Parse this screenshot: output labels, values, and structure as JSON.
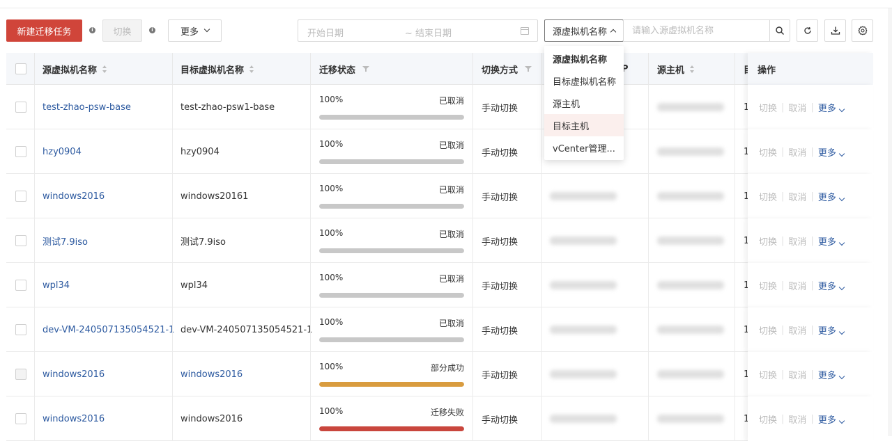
{
  "toolbar": {
    "new_task_label": "新建迁移任务",
    "switch_label": "切换",
    "more_label": "更多",
    "info_mark": "i",
    "date_start_placeholder": "开始日期",
    "date_end_placeholder": "~ 结束日期",
    "field_select_value": "源虚拟机名称",
    "search_placeholder": "请输入源虚拟机名称"
  },
  "dropdown": {
    "options": [
      "源虚拟机名称",
      "目标虚拟机名称",
      "源主机",
      "目标主机",
      "vCenter管理..."
    ],
    "selected": "源虚拟机名称",
    "hovered": "目标主机"
  },
  "table": {
    "columns": {
      "source_vm": "源虚拟机名称",
      "target_vm": "目标虚拟机名称",
      "status": "迁移状态",
      "switch_mode": "切换方式",
      "ip_partial": "P",
      "source_host": "源主机",
      "target_host_partial": "目",
      "actions": "操作"
    },
    "rows": [
      {
        "source_vm": "test-zhao-psw-base",
        "target_vm": "test-zhao-psw1-base",
        "target_is_link": false,
        "progress": "100%",
        "progress_value": 100,
        "status": "已取消",
        "bar_color": "#c8c8c8",
        "switch_mode": "手动切换",
        "target_host_partial": "1",
        "checkbox_disabled": false
      },
      {
        "source_vm": "hzy0904",
        "target_vm": "hzy0904",
        "target_is_link": false,
        "progress": "100%",
        "progress_value": 100,
        "status": "已取消",
        "bar_color": "#c8c8c8",
        "switch_mode": "手动切换",
        "target_host_partial": "1",
        "checkbox_disabled": false
      },
      {
        "source_vm": "windows2016",
        "target_vm": "windows20161",
        "target_is_link": false,
        "progress": "100%",
        "progress_value": 100,
        "status": "已取消",
        "bar_color": "#c8c8c8",
        "switch_mode": "手动切换",
        "target_host_partial": "1",
        "checkbox_disabled": false
      },
      {
        "source_vm": "测试7.9iso",
        "target_vm": "测试7.9iso",
        "target_is_link": false,
        "progress": "100%",
        "progress_value": 100,
        "status": "已取消",
        "bar_color": "#c8c8c8",
        "switch_mode": "手动切换",
        "target_host_partial": "1",
        "checkbox_disabled": false
      },
      {
        "source_vm": "wpl34",
        "target_vm": "wpl34",
        "target_is_link": false,
        "progress": "100%",
        "progress_value": 100,
        "status": "已取消",
        "bar_color": "#c8c8c8",
        "switch_mode": "手动切换",
        "target_host_partial": "1",
        "checkbox_disabled": false
      },
      {
        "source_vm": "dev-VM-240507135054521-1",
        "target_vm": "dev-VM-240507135054521-1",
        "target_is_link": false,
        "progress": "100%",
        "progress_value": 100,
        "status": "已取消",
        "bar_color": "#c8c8c8",
        "switch_mode": "手动切换",
        "target_host_partial": "1",
        "checkbox_disabled": false
      },
      {
        "source_vm": "windows2016",
        "target_vm": "windows2016",
        "target_is_link": true,
        "progress": "100%",
        "progress_value": 100,
        "status": "部分成功",
        "bar_color": "#d99c3f",
        "switch_mode": "手动切换",
        "target_host_partial": "1",
        "checkbox_disabled": true
      },
      {
        "source_vm": "windows2016",
        "target_vm": "windows2016",
        "target_is_link": false,
        "progress": "100%",
        "progress_value": 100,
        "status": "迁移失败",
        "bar_color": "#c9463d",
        "switch_mode": "手动切换",
        "target_host_partial": "1",
        "checkbox_disabled": false
      }
    ],
    "row_actions": {
      "switch": "切换",
      "cancel": "取消",
      "more": "更多",
      "separator": "|"
    }
  },
  "colors": {
    "primary": "#d0453a",
    "link": "#2d5aa0",
    "partial_success": "#d99c3f",
    "failed": "#c9463d",
    "cancelled": "#c8c8c8"
  }
}
